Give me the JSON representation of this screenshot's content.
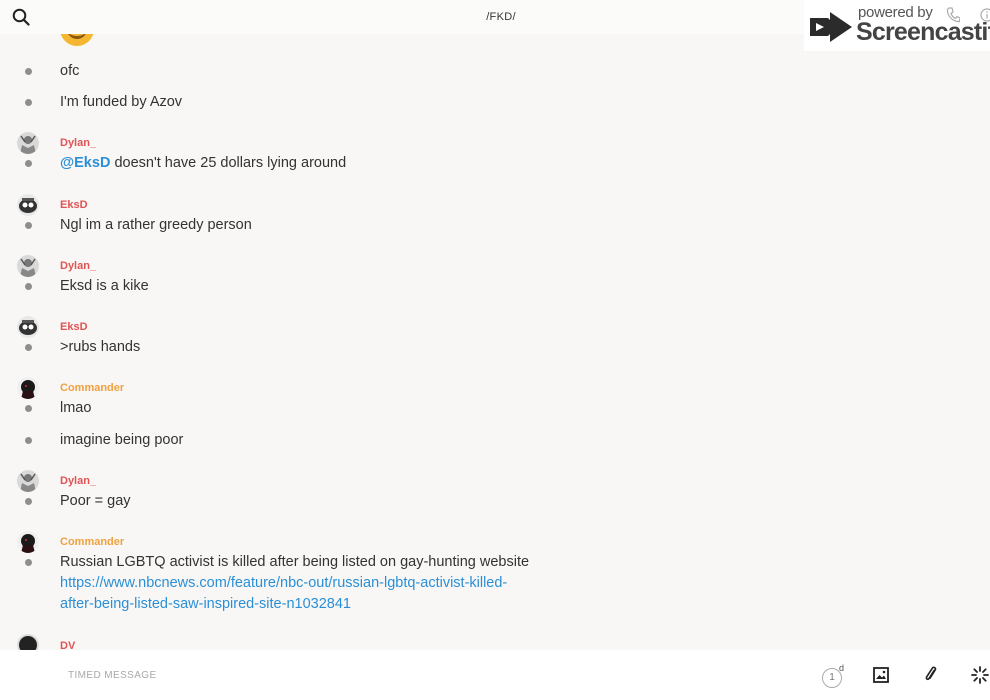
{
  "header": {
    "channel_title": "/FKD/",
    "search_icon": "search-icon"
  },
  "watermark": {
    "powered_label": "powered by",
    "brand": "Screencastify"
  },
  "colors": {
    "author_red": "#e05454",
    "author_orange": "#f0a040",
    "link_blue": "#2a8fd6"
  },
  "messages": [
    {
      "author": "",
      "text": "ofc"
    },
    {
      "author": "",
      "text": "I'm funded by Azov"
    },
    {
      "author": "Dylan_",
      "mention": "@EksD",
      "text": " doesn't have 25 dollars lying around"
    },
    {
      "author": "EksD",
      "text": "Ngl im a rather greedy person"
    },
    {
      "author": "Dylan_",
      "text": "Eksd is a kike"
    },
    {
      "author": "EksD",
      "text": ">rubs hands"
    },
    {
      "author": "Commander",
      "text": "lmao"
    },
    {
      "author": "",
      "text": "imagine being poor"
    },
    {
      "author": "Dylan_",
      "text": "Poor = gay"
    },
    {
      "author": "Commander",
      "text": "Russian LGBTQ activist is killed after being listed on gay-hunting website",
      "link": "https://www.nbcnews.com/feature/nbc-out/russian-lgbtq-activist-killed-after-being-listed-saw-inspired-site-n1032841"
    },
    {
      "author": "DV",
      "text": ""
    }
  ],
  "composer": {
    "placeholder": "TIMED MESSAGE",
    "timer_value": "1",
    "timer_unit": "d"
  }
}
